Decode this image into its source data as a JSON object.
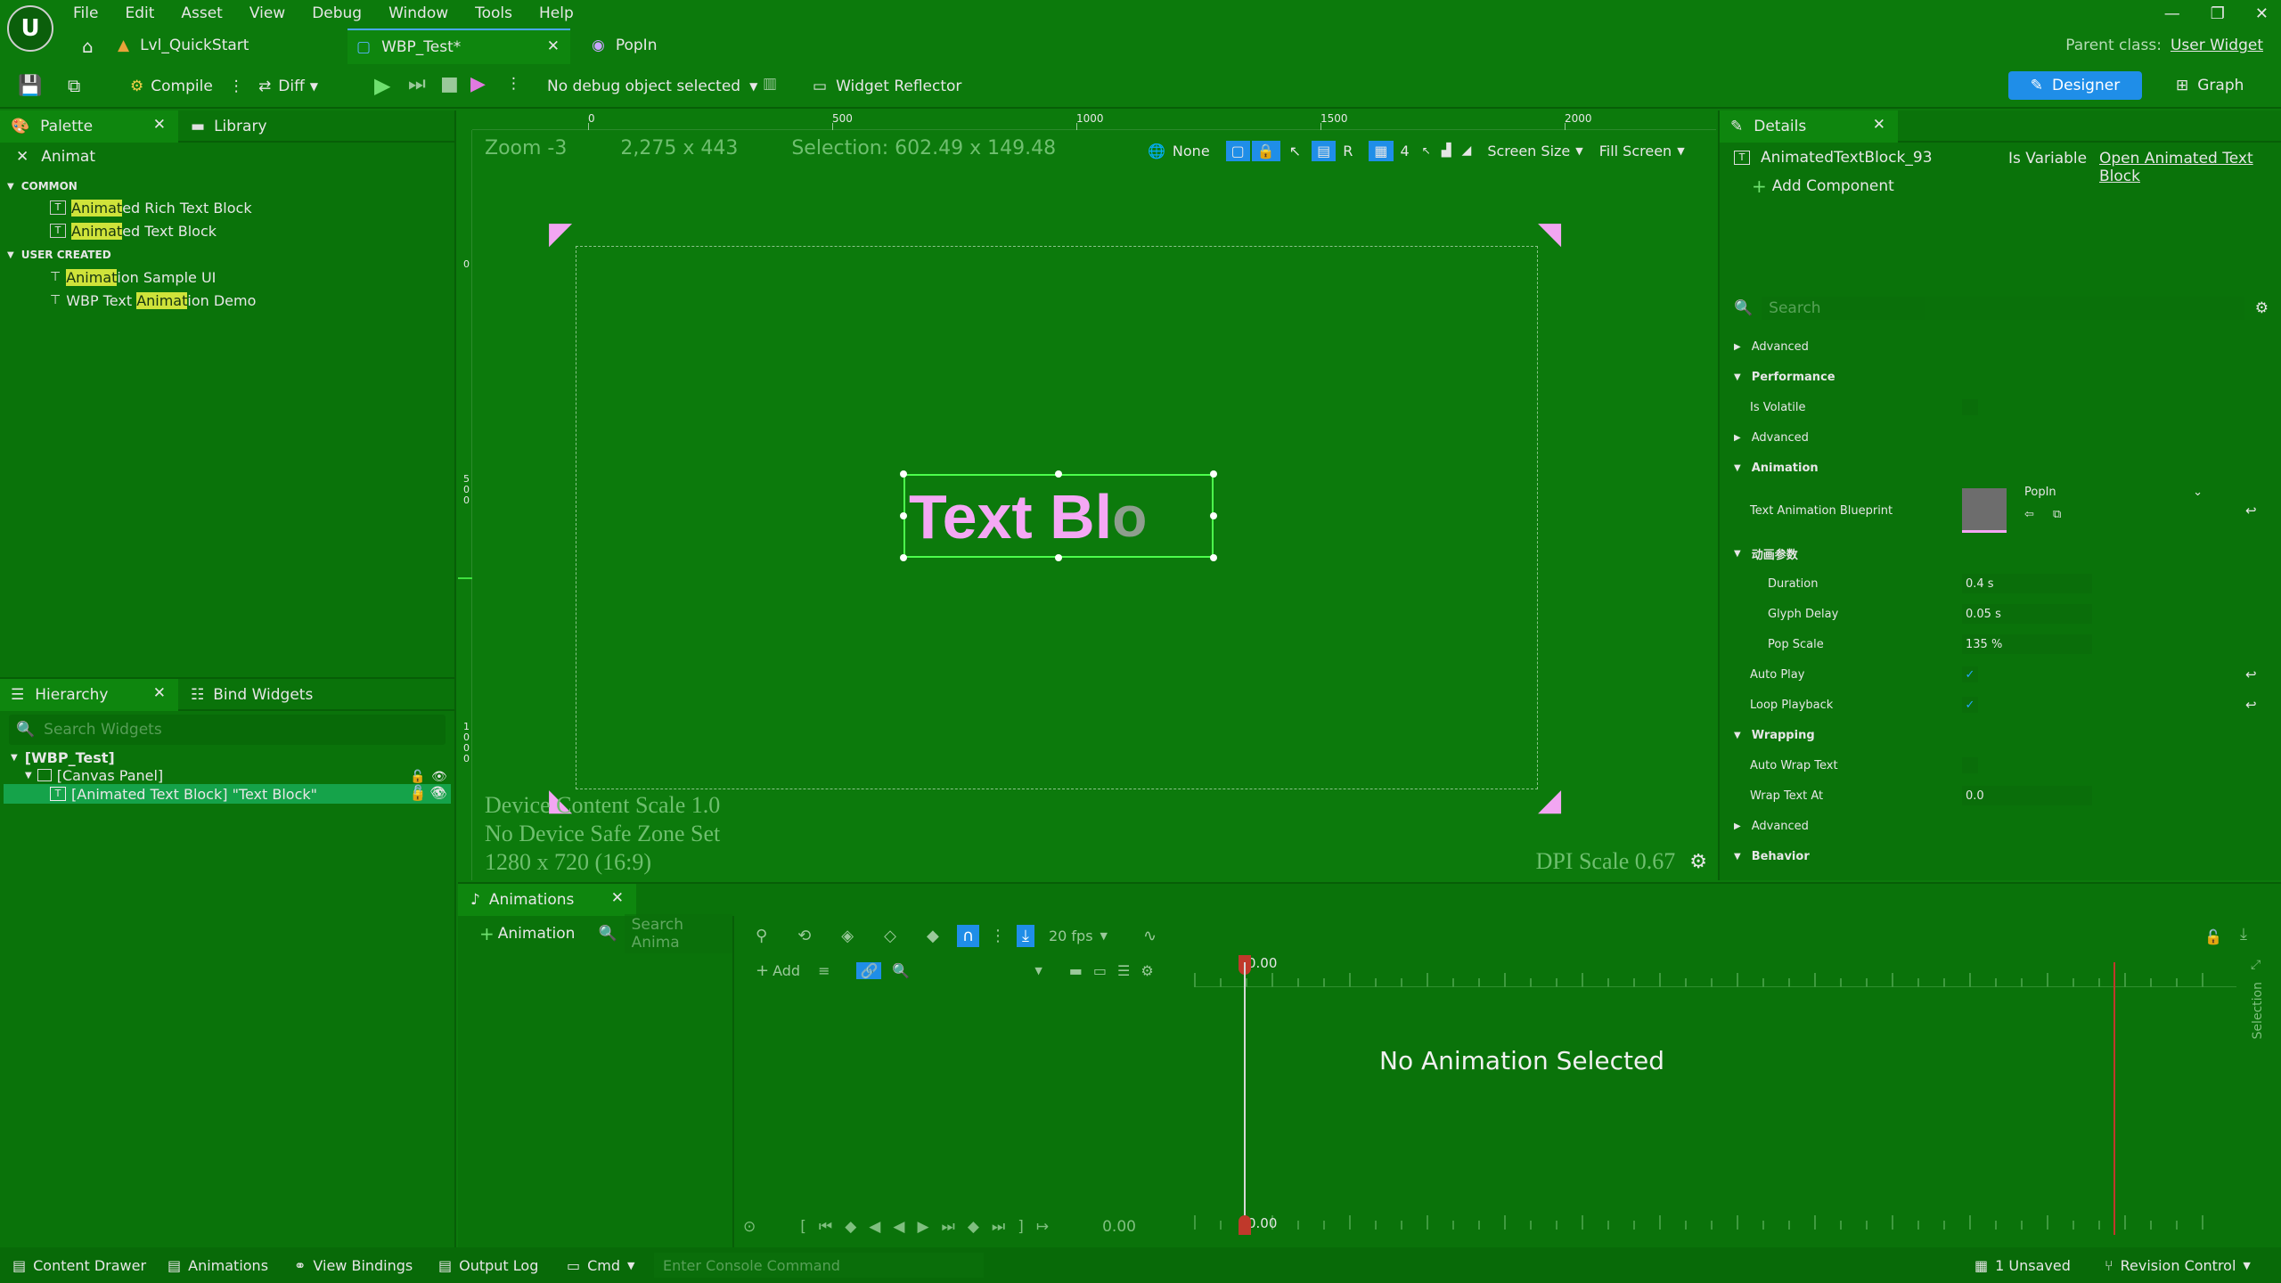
{
  "menu": [
    "File",
    "Edit",
    "Asset",
    "View",
    "Debug",
    "Window",
    "Tools",
    "Help"
  ],
  "doc_tabs": [
    {
      "label": "Lvl_QuickStart"
    },
    {
      "label": "WBP_Test*"
    },
    {
      "label": "PopIn"
    }
  ],
  "parent_class": {
    "label": "Parent class:",
    "value": "User Widget"
  },
  "toolbar": {
    "compile": "Compile",
    "diff": "Diff",
    "debug_object": "No debug object selected",
    "widget_reflector": "Widget Reflector",
    "designer": "Designer",
    "graph": "Graph"
  },
  "palette": {
    "tab": "Palette",
    "library": "Library",
    "search": "Animat",
    "groups": [
      {
        "name": "COMMON",
        "items": [
          {
            "pre": "",
            "hl": "Animat",
            "post": "ed Rich Text Block"
          },
          {
            "pre": "",
            "hl": "Animat",
            "post": "ed Text Block"
          }
        ]
      },
      {
        "name": "USER CREATED",
        "items": [
          {
            "pre": "",
            "hl": "Animat",
            "post": "ion Sample UI"
          },
          {
            "pre": "WBP Text ",
            "hl": "Animat",
            "post": "ion Demo"
          }
        ]
      }
    ]
  },
  "hierarchy": {
    "tab": "Hierarchy",
    "bind_widgets": "Bind Widgets",
    "search_placeholder": "Search Widgets",
    "items": [
      "[WBP_Test]",
      "[Canvas Panel]",
      "[Animated Text Block] \"Text Block\""
    ]
  },
  "viewport": {
    "zoom": "Zoom -3",
    "size": "2,275 x 443",
    "selection": "Selection: 602.49 x 149.48",
    "none": "None",
    "r": "R",
    "grid": "4",
    "screen_size": "Screen Size",
    "fill_screen": "Fill Screen",
    "ruler_top": [
      "0",
      "500",
      "1000",
      "1500",
      "2000"
    ],
    "ruler_left_a": "0",
    "ruler_left_b": "500",
    "ruler_left_c": "1000",
    "text_block": "Text Bl",
    "text_block_ghost": "o",
    "device_content_scale": "Device Content Scale 1.0",
    "safe_zone": "No Device Safe Zone Set",
    "resolution": "1280 x 720 (16:9)",
    "dpi": "DPI Scale 0.67"
  },
  "details": {
    "tab": "Details",
    "widget_name": "AnimatedTextBlock_93",
    "is_variable": "Is Variable",
    "open_link": "Open Animated Text Block",
    "add_component": "Add Component",
    "search_placeholder": "Search",
    "rows": [
      {
        "type": "sub",
        "label": "Advanced",
        "open": false
      },
      {
        "type": "cat",
        "label": "Performance",
        "open": true
      },
      {
        "type": "prop",
        "label": "Is Volatile",
        "kind": "check",
        "value": ""
      },
      {
        "type": "sub",
        "label": "Advanced",
        "open": false
      },
      {
        "type": "cat",
        "label": "Animation",
        "open": true
      },
      {
        "type": "prop",
        "label": "Text Animation Blueprint",
        "kind": "asset",
        "value": "PopIn"
      },
      {
        "type": "cat",
        "label": "动画参数",
        "open": true
      },
      {
        "type": "prop2",
        "label": "Duration",
        "kind": "num",
        "value": "0.4 s"
      },
      {
        "type": "prop2",
        "label": "Glyph Delay",
        "kind": "num",
        "value": "0.05 s"
      },
      {
        "type": "prop2",
        "label": "Pop Scale",
        "kind": "num",
        "value": "135 %"
      },
      {
        "type": "prop",
        "label": "Auto Play",
        "kind": "checked",
        "value": "✓"
      },
      {
        "type": "prop",
        "label": "Loop Playback",
        "kind": "checked",
        "value": "✓"
      },
      {
        "type": "cat",
        "label": "Wrapping",
        "open": true
      },
      {
        "type": "prop",
        "label": "Auto Wrap Text",
        "kind": "check",
        "value": ""
      },
      {
        "type": "prop",
        "label": "Wrap Text At",
        "kind": "num",
        "value": "0.0"
      },
      {
        "type": "sub",
        "label": "Advanced",
        "open": false
      },
      {
        "type": "cat",
        "label": "Behavior",
        "open": true
      }
    ]
  },
  "animations": {
    "tab": "Animations",
    "add_animation": "Animation",
    "search_placeholder": "Search Anima",
    "fps": "20 fps",
    "add": "Add",
    "time_top": "0.00",
    "time_bottom": "0.00",
    "time_left": "0.00",
    "empty": "No Animation Selected",
    "selection_vert": "Selection"
  },
  "status": {
    "content_drawer": "Content Drawer",
    "animations": "Animations",
    "view_bindings": "View Bindings",
    "output_log": "Output Log",
    "cmd": "Cmd",
    "console_placeholder": "Enter Console Command",
    "unsaved": "1 Unsaved",
    "revision": "Revision Control"
  }
}
